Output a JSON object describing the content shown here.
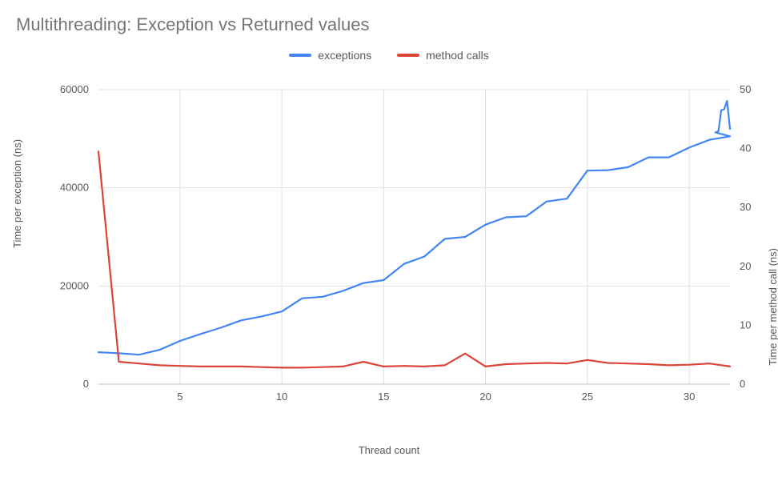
{
  "title": "Multithreading: Exception vs Returned values",
  "legend": {
    "exceptions": {
      "label": "exceptions",
      "color": "#4285f4"
    },
    "method_calls": {
      "label": "method calls",
      "color": "#db4437"
    }
  },
  "xlabel": "Thread count",
  "ylabel_left": "Time per exception (ns)",
  "ylabel_right": "Time per method call (ns)",
  "chart_data": {
    "type": "line",
    "x": [
      1,
      2,
      3,
      4,
      5,
      6,
      7,
      8,
      9,
      10,
      11,
      12,
      13,
      14,
      15,
      16,
      17,
      18,
      19,
      20,
      21,
      22,
      23,
      24,
      25,
      26,
      27,
      28,
      29,
      30,
      31,
      32
    ],
    "x_ticks": [
      5,
      10,
      15,
      20,
      25,
      30
    ],
    "y_left_ticks": [
      0,
      20000,
      40000,
      60000
    ],
    "y_right_ticks": [
      0,
      10,
      20,
      30,
      40,
      50
    ],
    "y_left_range": [
      0,
      60000
    ],
    "y_right_range": [
      0,
      50
    ],
    "xlabel": "Thread count",
    "ylabel_left": "Time per exception (ns)",
    "ylabel_right": "Time per method call (ns)",
    "series": [
      {
        "name": "exceptions",
        "axis": "left",
        "color": "#4285f4",
        "values": [
          6500,
          6300,
          6000,
          7000,
          8800,
          10200,
          11500,
          13000,
          13800,
          14800,
          17500,
          17800,
          19000,
          20600,
          21200,
          24500,
          26000,
          29600,
          30000,
          32500,
          34000,
          34200,
          37200,
          37800,
          43500,
          43600,
          44200,
          46200,
          46200,
          48200,
          49800,
          50500,
          51300,
          51500,
          55800,
          56000,
          57700,
          52000
        ]
      },
      {
        "name": "method calls",
        "axis": "right",
        "color": "#db4437",
        "values": [
          39.5,
          3.8,
          3.5,
          3.2,
          3.1,
          3.0,
          3.0,
          3.0,
          2.9,
          2.8,
          2.8,
          2.9,
          3.0,
          3.8,
          3.0,
          3.1,
          3.0,
          3.2,
          5.2,
          3.0,
          3.4,
          3.5,
          3.6,
          3.5,
          4.1,
          3.6,
          3.5,
          3.4,
          3.2,
          3.3,
          3.5,
          3.0
        ]
      }
    ]
  }
}
